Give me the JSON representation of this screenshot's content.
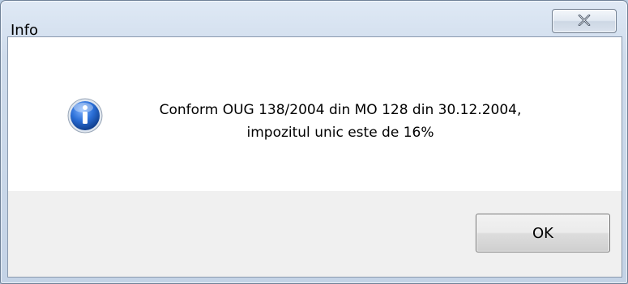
{
  "window": {
    "title": "Info",
    "close_icon": "close-x-icon"
  },
  "message": {
    "line1": "Conform OUG 138/2004 din MO 128 din 30.12.2004,",
    "line2": "impozitul unic este de 16%",
    "icon": "info-icon"
  },
  "buttons": {
    "ok_label": "OK"
  },
  "colors": {
    "icon_blue": "#1f5fbf",
    "footer_bg": "#f0f0f0",
    "client_bg": "#ffffff"
  }
}
